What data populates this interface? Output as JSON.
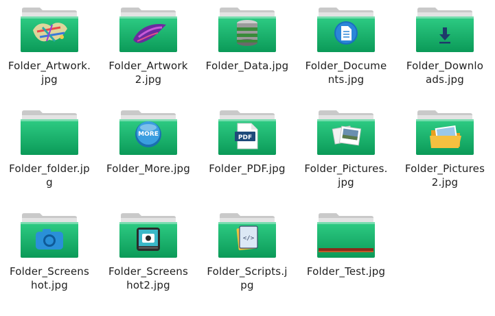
{
  "items": [
    {
      "label": "Folder_Artwork.\njpg",
      "emblem": "artwork-splash-icon"
    },
    {
      "label": "Folder_Artwork\n2.jpg",
      "emblem": "artwork-brush-icon"
    },
    {
      "label": "Folder_Data.jpg",
      "emblem": "database-icon"
    },
    {
      "label": "Folder_Docume\nnts.jpg",
      "emblem": "document-icon"
    },
    {
      "label": "Folder_Downlo\nads.jpg",
      "emblem": "download-arrow-icon"
    },
    {
      "label": "Folder_folder.jp\ng",
      "emblem": "none"
    },
    {
      "label": "Folder_More.jpg",
      "emblem": "more-icon",
      "emblem_text": "MORE"
    },
    {
      "label": "Folder_PDF.jpg",
      "emblem": "pdf-icon",
      "emblem_text": "PDF"
    },
    {
      "label": "Folder_Pictures.\njpg",
      "emblem": "photos-icon"
    },
    {
      "label": "Folder_Pictures\n2.jpg",
      "emblem": "picture-folder-icon"
    },
    {
      "label": "Folder_Screens\nhot.jpg",
      "emblem": "camera-icon"
    },
    {
      "label": "Folder_Screens\nhot2.jpg",
      "emblem": "screenshot-camera-icon"
    },
    {
      "label": "Folder_Scripts.j\npg",
      "emblem": "script-code-icon",
      "emblem_text": "</>"
    },
    {
      "label": "Folder_Test.jpg",
      "emblem": "test-stripe-icon"
    }
  ],
  "colors": {
    "folder_green_top": "#2ecc84",
    "folder_green_bottom": "#0b9a58",
    "folder_tab": "#c9c9c9",
    "folder_back": "#e3e3e3",
    "label_text": "#202020"
  }
}
